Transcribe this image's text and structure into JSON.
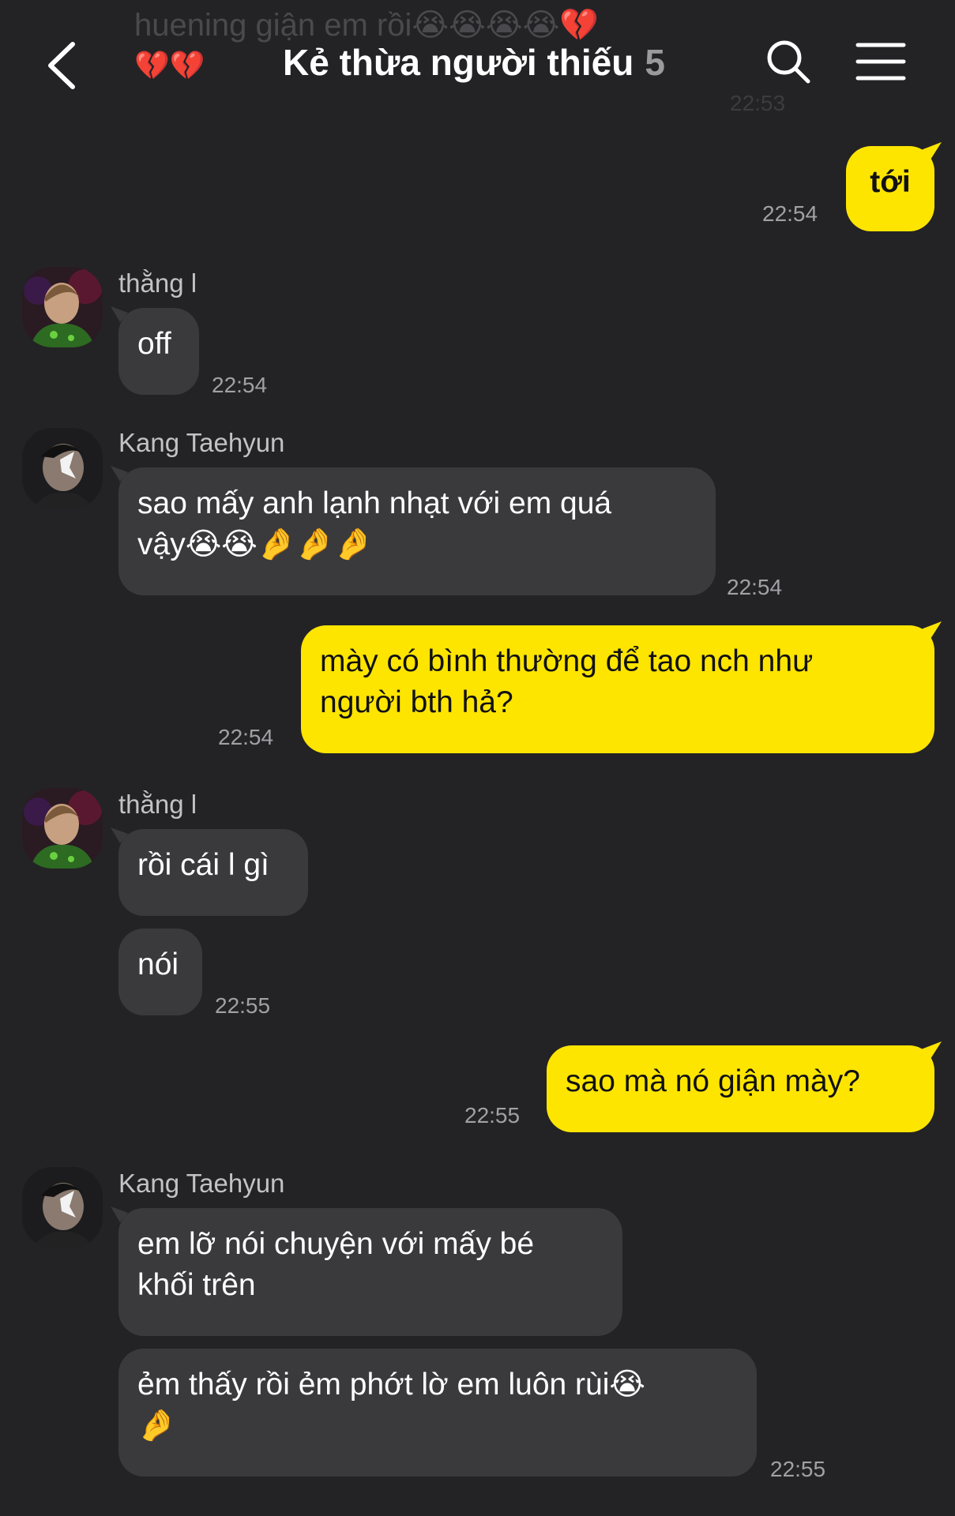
{
  "header": {
    "title": "Kẻ thừa người thiếu",
    "member_count": "5"
  },
  "faded_message": {
    "text": "huening giận em rồi😭😭😭😭💔",
    "hearts": "💔💔",
    "time": "22:53"
  },
  "messages": [
    {
      "side": "out",
      "text": "tới",
      "time": "22:54"
    },
    {
      "side": "in",
      "sender": "thằng l",
      "text": "off",
      "time": "22:54"
    },
    {
      "side": "in",
      "sender": "Kang Taehyun",
      "line1": "sao mấy anh lạnh nhạt với em quá",
      "line2": "vậy😭😭🤌🤌🤌",
      "time": "22:54"
    },
    {
      "side": "out",
      "line1": "mày có bình thường để tao nch như",
      "line2": "người bth hả?",
      "time": "22:54"
    },
    {
      "side": "in",
      "sender": "thằng l",
      "text": "rồi cái l gì"
    },
    {
      "side": "in",
      "text": "nói",
      "time": "22:55"
    },
    {
      "side": "out",
      "text": "sao mà nó giận mày?",
      "time": "22:55"
    },
    {
      "side": "in",
      "sender": "Kang Taehyun",
      "line1": "em lỡ nói chuyện với mấy bé",
      "line2": "khối trên"
    },
    {
      "side": "in",
      "line1": "ẻm thấy rồi ẻm phớt lờ em luôn rùi😭",
      "line2": "🤌",
      "time": "22:55"
    }
  ],
  "icons": {
    "back": "chevron-left-icon",
    "search": "search-icon",
    "menu": "hamburger-menu-icon"
  },
  "colors": {
    "background": "#232325",
    "incoming_bubble": "#3a3a3c",
    "outgoing_bubble": "#fee500"
  }
}
